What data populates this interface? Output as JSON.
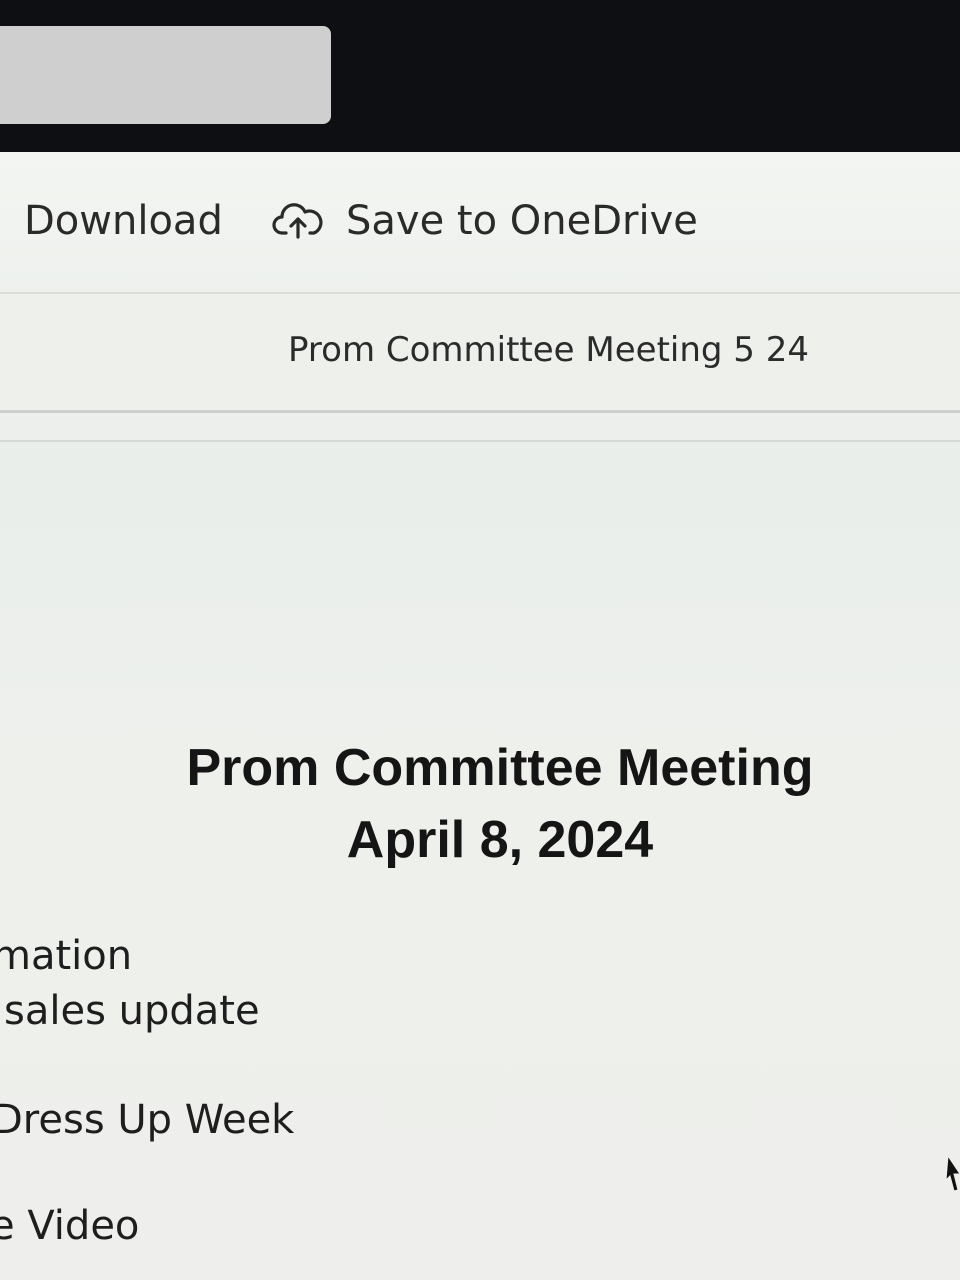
{
  "toolbar": {
    "download_label": "Download",
    "save_label": "Save to OneDrive",
    "save_icon": "cloud-upload-icon"
  },
  "document": {
    "name": "Prom Committee Meeting 5 24",
    "title": "Prom Committee Meeting",
    "date": "April 8, 2024",
    "agenda": [
      "mation",
      "sales update",
      "Dress Up Week",
      "e Video"
    ]
  }
}
